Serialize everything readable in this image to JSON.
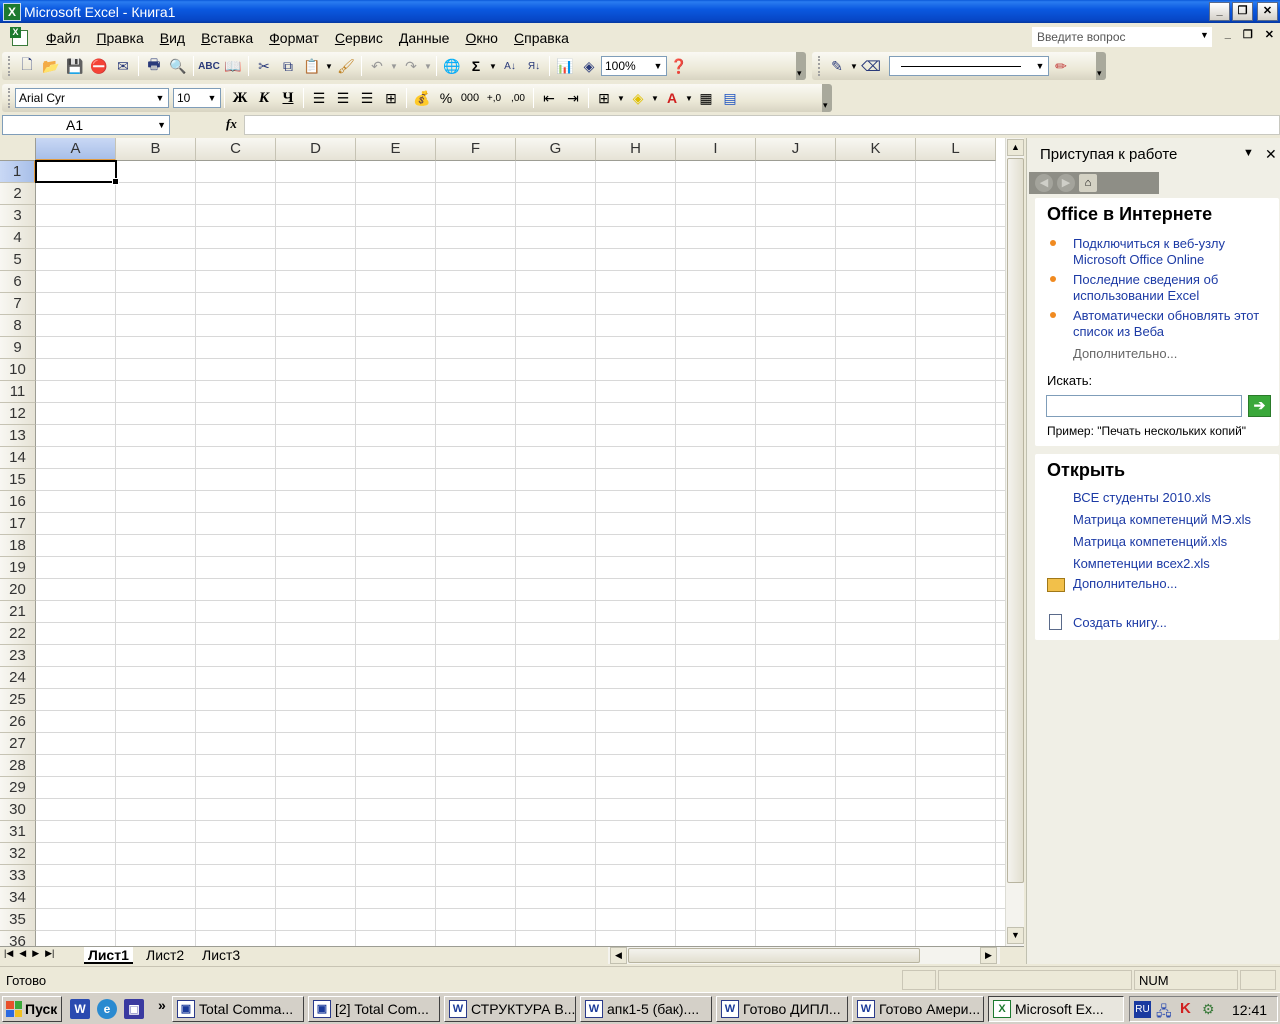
{
  "window": {
    "title": "Microsoft Excel - Книга1"
  },
  "menu": {
    "items": [
      {
        "label": "Файл",
        "accel": "Ф",
        "rest": "айл"
      },
      {
        "label": "Правка",
        "accel": "П",
        "rest": "равка"
      },
      {
        "label": "Вид",
        "accel": "В",
        "rest": "ид"
      },
      {
        "label": "Вставка",
        "accel": "В",
        "rest": "ставка"
      },
      {
        "label": "Формат",
        "accel": "Ф",
        "rest": "ормат"
      },
      {
        "label": "Сервис",
        "accel": "С",
        "rest": "ервис"
      },
      {
        "label": "Данные",
        "accel": "Д",
        "rest": "анные"
      },
      {
        "label": "Окно",
        "accel": "О",
        "rest": "кно"
      },
      {
        "label": "Справка",
        "accel": "С",
        "rest": "правка"
      }
    ],
    "help_placeholder": "Введите вопрос"
  },
  "toolbar": {
    "zoom": "100%",
    "font": "Arial Cyr",
    "font_size": "10",
    "bold": "Ж",
    "italic": "К",
    "underline": "Ч",
    "percent": "%",
    "thousands": "000",
    "inc_decimal": "+,0",
    "dec_decimal": ",00"
  },
  "formula_bar": {
    "name_box": "A1",
    "fx": "fx",
    "formula": ""
  },
  "grid": {
    "columns": [
      "A",
      "B",
      "C",
      "D",
      "E",
      "F",
      "G",
      "H",
      "I",
      "J",
      "K",
      "L"
    ],
    "rows": [
      "1",
      "2",
      "3",
      "4",
      "5",
      "6",
      "7",
      "8",
      "9",
      "10",
      "11",
      "12",
      "13",
      "14",
      "15",
      "16",
      "17",
      "18",
      "19",
      "20",
      "21",
      "22",
      "23",
      "24",
      "25",
      "26",
      "27",
      "28",
      "29",
      "30",
      "31",
      "32",
      "33",
      "34",
      "35",
      "36"
    ],
    "active_cell": "A1"
  },
  "sheets": [
    "Лист1",
    "Лист2",
    "Лист3"
  ],
  "task_pane": {
    "title": "Приступая к работе",
    "online": {
      "title": "Office в Интернете",
      "link1_line1": "Подключиться к веб-узлу",
      "link1_line2": "Microsoft Office Online",
      "link2_line1": "Последние сведения об",
      "link2_line2": "использовании Excel",
      "link3_line1": "Автоматически обновлять этот",
      "link3_line2": "список из Веба",
      "more": "Дополнительно...",
      "search_label": "Искать:",
      "example": "Пример:  \"Печать нескольких копий\""
    },
    "open": {
      "title": "Открыть",
      "files": [
        "ВСЕ студенты 2010.xls",
        "Матрица компетенций МЭ.xls",
        "Матрица компетенций.xls",
        "Компетенции всех2.xls"
      ],
      "more": "Дополнительно...",
      "create": "Создать книгу..."
    }
  },
  "status": {
    "ready": "Готово",
    "num": "NUM"
  },
  "taskbar": {
    "start": "Пуск",
    "overflow": "»",
    "buttons": [
      "Total Comma...",
      "[2] Total Com...",
      "СТРУКТУРА В...",
      "апк1-5 (бак)....",
      "Готово ДИПЛ...",
      "Готово Амери...",
      "Microsoft Ex..."
    ],
    "lang": "RU",
    "time": "12:41"
  }
}
